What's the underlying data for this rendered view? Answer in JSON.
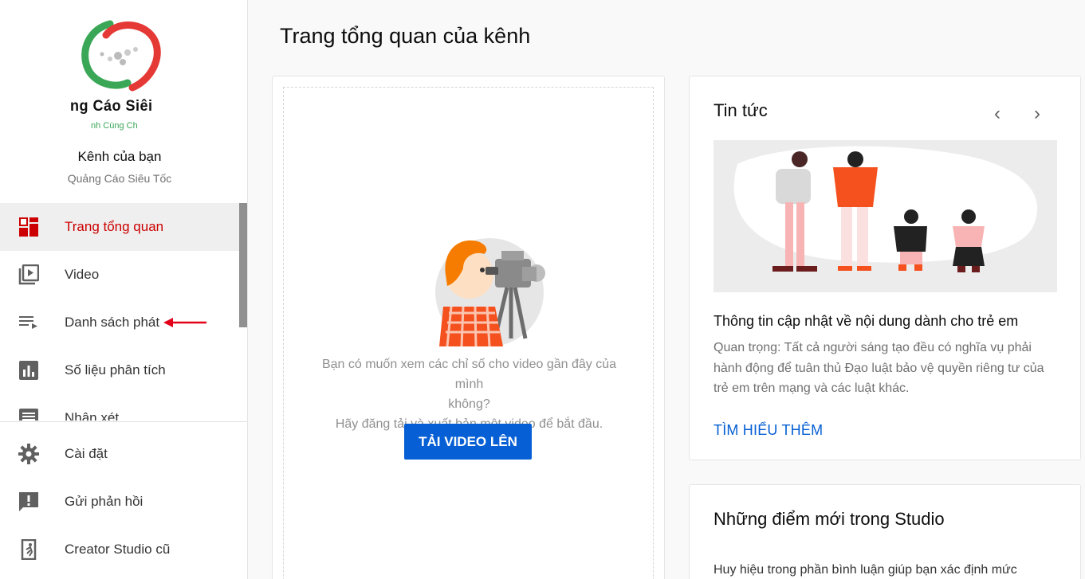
{
  "sidebar": {
    "logo_text": "ng Cáo Siêi",
    "logo_sub": "nh Cùng Ch",
    "channel_name": "Kênh của bạn",
    "channel_sub": "Quảng Cáo Siêu Tốc",
    "items": [
      {
        "label": "Trang tổng quan",
        "icon": "dashboard-icon",
        "active": true
      },
      {
        "label": "Video",
        "icon": "video-library-icon"
      },
      {
        "label": "Danh sách phát",
        "icon": "playlist-icon"
      },
      {
        "label": "Số liệu phân tích",
        "icon": "analytics-icon"
      },
      {
        "label": "Nhận xét",
        "icon": "comments-icon"
      }
    ],
    "bottom_items": [
      {
        "label": "Cài đặt",
        "icon": "gear-icon"
      },
      {
        "label": "Gửi phản hồi",
        "icon": "feedback-icon"
      },
      {
        "label": "Creator Studio cũ",
        "icon": "exit-icon"
      }
    ],
    "colors": {
      "active": "#cc0000",
      "arrow": "#e3001b"
    }
  },
  "main": {
    "title": "Trang tổng quan của kênh",
    "upload_card": {
      "text_line1": "Bạn có muốn xem các chỉ số cho video gần đây của mình",
      "text_line2": "không?",
      "text_line3": "Hãy đăng tải và xuất bản một video để bắt đầu.",
      "button": "TẢI VIDEO LÊN"
    },
    "news_card": {
      "title": "Tin tức",
      "headline": "Thông tin cập nhật về nội dung dành cho trẻ em",
      "body": "Quan trọng: Tất cả người sáng tạo đều có nghĩa vụ phải hành động để tuân thủ Đạo luật bảo vệ quyền riêng tư của trẻ em trên mạng và các luật khác.",
      "link": "TÌM HIỂU THÊM",
      "prev_icon": "chevron-left-icon",
      "next_icon": "chevron-right-icon"
    },
    "whatsnew_card": {
      "title": "Những điểm mới trong Studio",
      "body": "Huy hiệu trong phần bình luận giúp bạn xác định mức"
    },
    "colors": {
      "accent": "#065fd4"
    }
  }
}
